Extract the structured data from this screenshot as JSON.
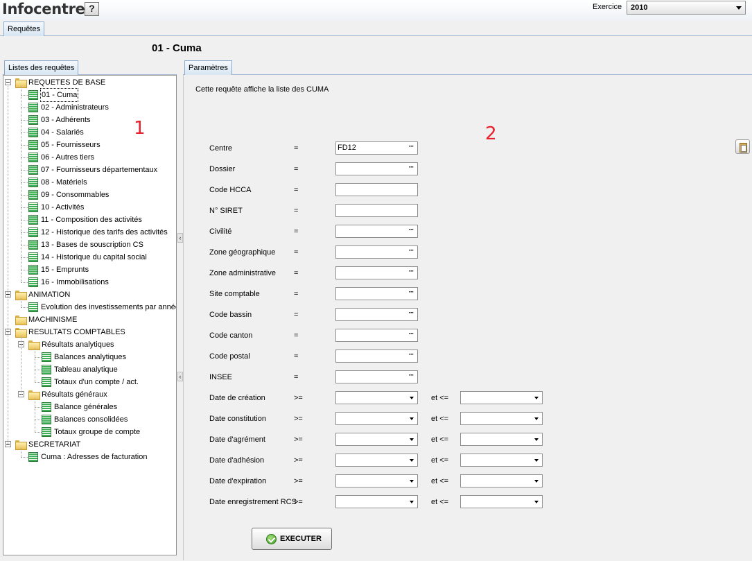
{
  "app": {
    "title": "Infocentre",
    "help_symbol": "?"
  },
  "exercice": {
    "label": "Exercice",
    "value": "2010"
  },
  "tabs": {
    "top": "Requêtes",
    "left": "Listes des requêtes",
    "right": "Paramètres"
  },
  "page_title": "01 - Cuma",
  "annotations": [
    "1",
    "2"
  ],
  "tree": {
    "base": {
      "label": "REQUETES DE BASE",
      "items": [
        "01 - Cuma",
        "02 - Administrateurs",
        "03 - Adhérents",
        "04 - Salariés",
        "05 - Fournisseurs",
        "06 - Autres tiers",
        "07 - Fournisseurs départementaux",
        "08 - Matériels",
        "09 - Consommables",
        "10 - Activités",
        "11 - Composition des activités",
        "12 - Historique des tarifs des activités",
        "13 - Bases de souscription CS",
        "14 - Historique du capital social",
        "15 - Emprunts",
        "16 - Immobilisations"
      ],
      "selected": "01 - Cuma"
    },
    "animation": {
      "label": "ANIMATION",
      "items": [
        "Evolution des investissements par année"
      ]
    },
    "machinisme": {
      "label": "MACHINISME"
    },
    "comptables": {
      "label": "RESULTATS COMPTABLES",
      "analytiques": {
        "label": "Résultats analytiques",
        "items": [
          "Balances analytiques",
          "Tableau analytique",
          "Totaux d'un compte / act."
        ]
      },
      "generaux": {
        "label": "Résultats généraux",
        "items": [
          "Balance générales",
          "Balances consolidées",
          "Totaux groupe de compte"
        ]
      }
    },
    "secretariat": {
      "label": "SECRETARIAT",
      "items": [
        "Cuma : Adresses de facturation"
      ]
    }
  },
  "params": {
    "description": "Cette requête affiche la liste des CUMA",
    "ellipsis": "···",
    "fields": [
      {
        "label": "Centre",
        "op": "=",
        "value": "FD12",
        "picker": true
      },
      {
        "label": "Dossier",
        "op": "=",
        "value": "",
        "picker": true
      },
      {
        "label": "Code HCCA",
        "op": "=",
        "value": "",
        "picker": false
      },
      {
        "label": "N° SIRET",
        "op": "=",
        "value": "",
        "picker": false
      },
      {
        "label": "Civilité",
        "op": "=",
        "value": "",
        "picker": true
      },
      {
        "label": "Zone géographique",
        "op": "=",
        "value": "",
        "picker": true
      },
      {
        "label": "Zone administrative",
        "op": "=",
        "value": "",
        "picker": true
      },
      {
        "label": "Site comptable",
        "op": "=",
        "value": "",
        "picker": true
      },
      {
        "label": "Code bassin",
        "op": "=",
        "value": "",
        "picker": true
      },
      {
        "label": "Code canton",
        "op": "=",
        "value": "",
        "picker": true
      },
      {
        "label": "Code postal",
        "op": "=",
        "value": "",
        "picker": true
      },
      {
        "label": "INSEE",
        "op": "=",
        "value": "",
        "picker": true
      }
    ],
    "date_fields": [
      {
        "label": "Date de création",
        "op": ">=",
        "op2": "et <="
      },
      {
        "label": "Date constitution",
        "op": ">=",
        "op2": "et <="
      },
      {
        "label": "Date d'agrément",
        "op": ">=",
        "op2": "et <="
      },
      {
        "label": "Date d'adhésion",
        "op": ">=",
        "op2": "et <="
      },
      {
        "label": "Date d'expiration",
        "op": ">=",
        "op2": "et <="
      },
      {
        "label": "Date enregistrement RCS",
        "op": ">=",
        "op2": "et <="
      }
    ]
  },
  "execute_label": "EXECUTER"
}
